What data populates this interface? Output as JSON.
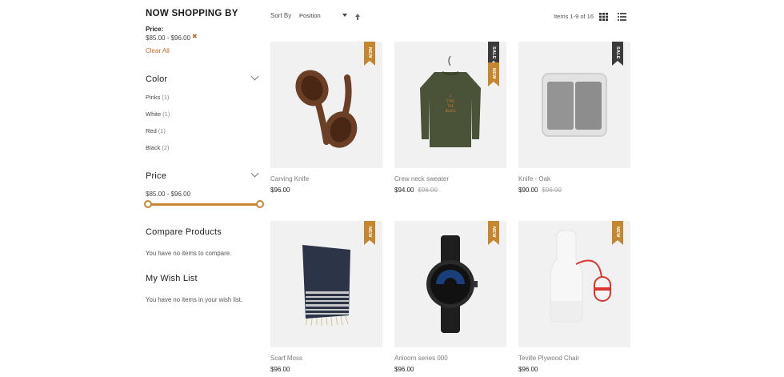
{
  "sidebar": {
    "now_shopping_title": "NOW SHOPPING BY",
    "active_filter": {
      "label": "Price:",
      "value": "$85.00 - $96.00",
      "remove_icon": "close-x-icon"
    },
    "clear_all": "Clear All",
    "color_section": {
      "title": "Color",
      "items": [
        {
          "label": "Pinks",
          "count": "(1)"
        },
        {
          "label": "White",
          "count": "(1)"
        },
        {
          "label": "Red",
          "count": "(1)"
        },
        {
          "label": "Black",
          "count": "(2)"
        }
      ]
    },
    "price_section": {
      "title": "Price",
      "range_text": "$85.00 - $96.00",
      "slider_min_fraction": 0,
      "slider_max_fraction": 1
    },
    "compare": {
      "title": "Compare Products",
      "empty_text": "You have no items to compare."
    },
    "wishlist": {
      "title": "My Wish List",
      "empty_text": "You have no items in your wish list."
    }
  },
  "toolbar": {
    "sort_label": "Sort By",
    "sort_value": "Position",
    "items_count": "Items 1-9 of 16",
    "sort_direction_icon": "arrow-up-icon",
    "view_modes": [
      "grid-view-icon",
      "list-view-icon"
    ]
  },
  "products": [
    {
      "name": "Carving Knife",
      "price": "$96.00",
      "old_price": "",
      "badges": [
        "NEW"
      ]
    },
    {
      "name": "Crew neck sweater",
      "price": "$94.00",
      "old_price": "$96.00",
      "badges": [
        "SALE",
        "NEW"
      ]
    },
    {
      "name": "Knife - Oak",
      "price": "$90.00",
      "old_price": "$96.00",
      "badges": [
        "SALE"
      ]
    },
    {
      "name": "Scarf Moss",
      "price": "$96.00",
      "old_price": "",
      "badges": [
        "NEW"
      ]
    },
    {
      "name": "Anioorn series 000",
      "price": "$96.00",
      "old_price": "",
      "badges": [
        "NEW"
      ]
    },
    {
      "name": "Teville Plywood Chair",
      "price": "$96.00",
      "old_price": "",
      "badges": [
        "NEW"
      ]
    }
  ],
  "colors": {
    "accent": "#c4682a",
    "new_badge": "#c4862f",
    "sale_badge": "#3a3a3a",
    "slider": "#c4862f"
  }
}
